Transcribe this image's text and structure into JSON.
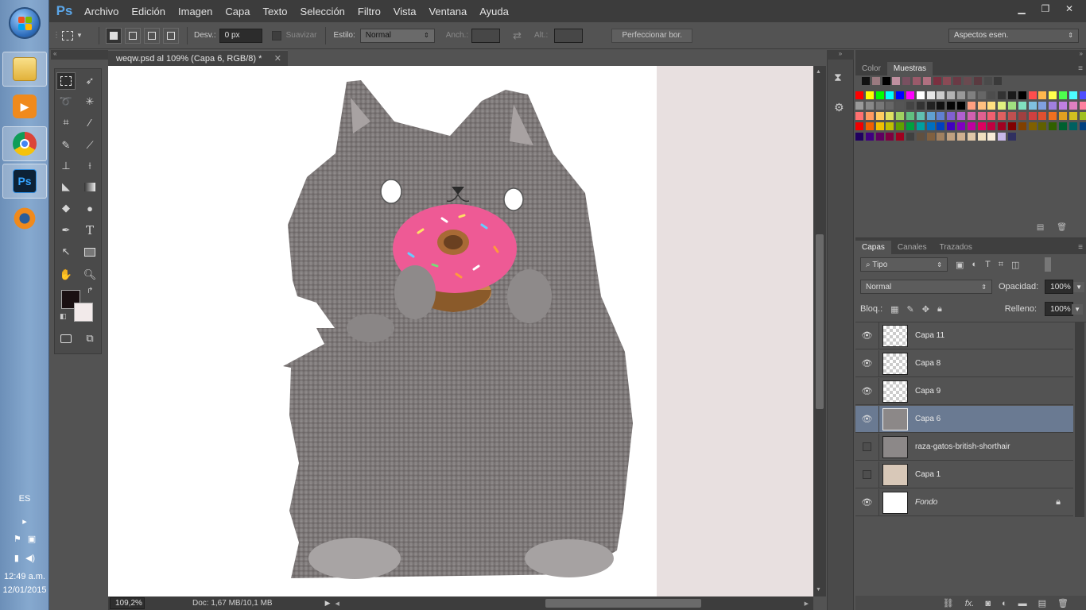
{
  "taskbar": {
    "language": "ES",
    "time": "12:49 a.m.",
    "date": "12/01/2015",
    "apps": [
      {
        "name": "explorer",
        "icon": "folder-icon",
        "active": true
      },
      {
        "name": "media-player",
        "icon": "media-player-icon",
        "active": false
      },
      {
        "name": "chrome",
        "icon": "chrome-icon",
        "active": true
      },
      {
        "name": "photoshop",
        "icon": "photoshop-icon",
        "label": "Ps",
        "active": true
      },
      {
        "name": "blender",
        "icon": "blender-icon",
        "active": false
      }
    ]
  },
  "app": {
    "logo": "Ps",
    "menu": [
      "Archivo",
      "Edición",
      "Imagen",
      "Capa",
      "Texto",
      "Selección",
      "Filtro",
      "Vista",
      "Ventana",
      "Ayuda"
    ]
  },
  "options": {
    "desv_label": "Desv.:",
    "desv_value": "0 px",
    "suavizar_label": "Suavizar",
    "estilo_label": "Estilo:",
    "estilo_value": "Normal",
    "anch_label": "Anch.:",
    "alt_label": "Alt.:",
    "refine_button": "Perfeccionar bor.",
    "workspace": "Aspectos esen."
  },
  "document": {
    "tab_title": "weqw.psd al 109% (Capa 6, RGB/8) *",
    "zoom": "109,2%",
    "doc_info": "Doc: 1,67 MB/10,1 MB"
  },
  "swatches_panel": {
    "tabs": [
      "Color",
      "Muestras"
    ],
    "active_tab": "Muestras"
  },
  "layers_panel": {
    "tabs": [
      "Capas",
      "Canales",
      "Trazados"
    ],
    "active_tab": "Capas",
    "filter": "Tipo",
    "blend_mode": "Normal",
    "opacity_label": "Opacidad:",
    "opacity": "100%",
    "lock_label": "Bloq.:",
    "fill_label": "Relleno:",
    "fill": "100%",
    "layers": [
      {
        "name": "Capa 11",
        "visible": true,
        "selected": false
      },
      {
        "name": "Capa 8",
        "visible": true,
        "selected": false
      },
      {
        "name": "Capa 9",
        "visible": true,
        "selected": false
      },
      {
        "name": "Capa 6",
        "visible": true,
        "selected": true
      },
      {
        "name": "raza-gatos-british-shorthair",
        "visible": false,
        "selected": false
      },
      {
        "name": "Capa 1",
        "visible": false,
        "selected": false
      },
      {
        "name": "Fondo",
        "visible": true,
        "selected": false,
        "locked": true
      }
    ]
  },
  "colors": {
    "foreground": "#1a1012",
    "background": "#f2eaea",
    "selected_layer": "#6a7a92"
  }
}
